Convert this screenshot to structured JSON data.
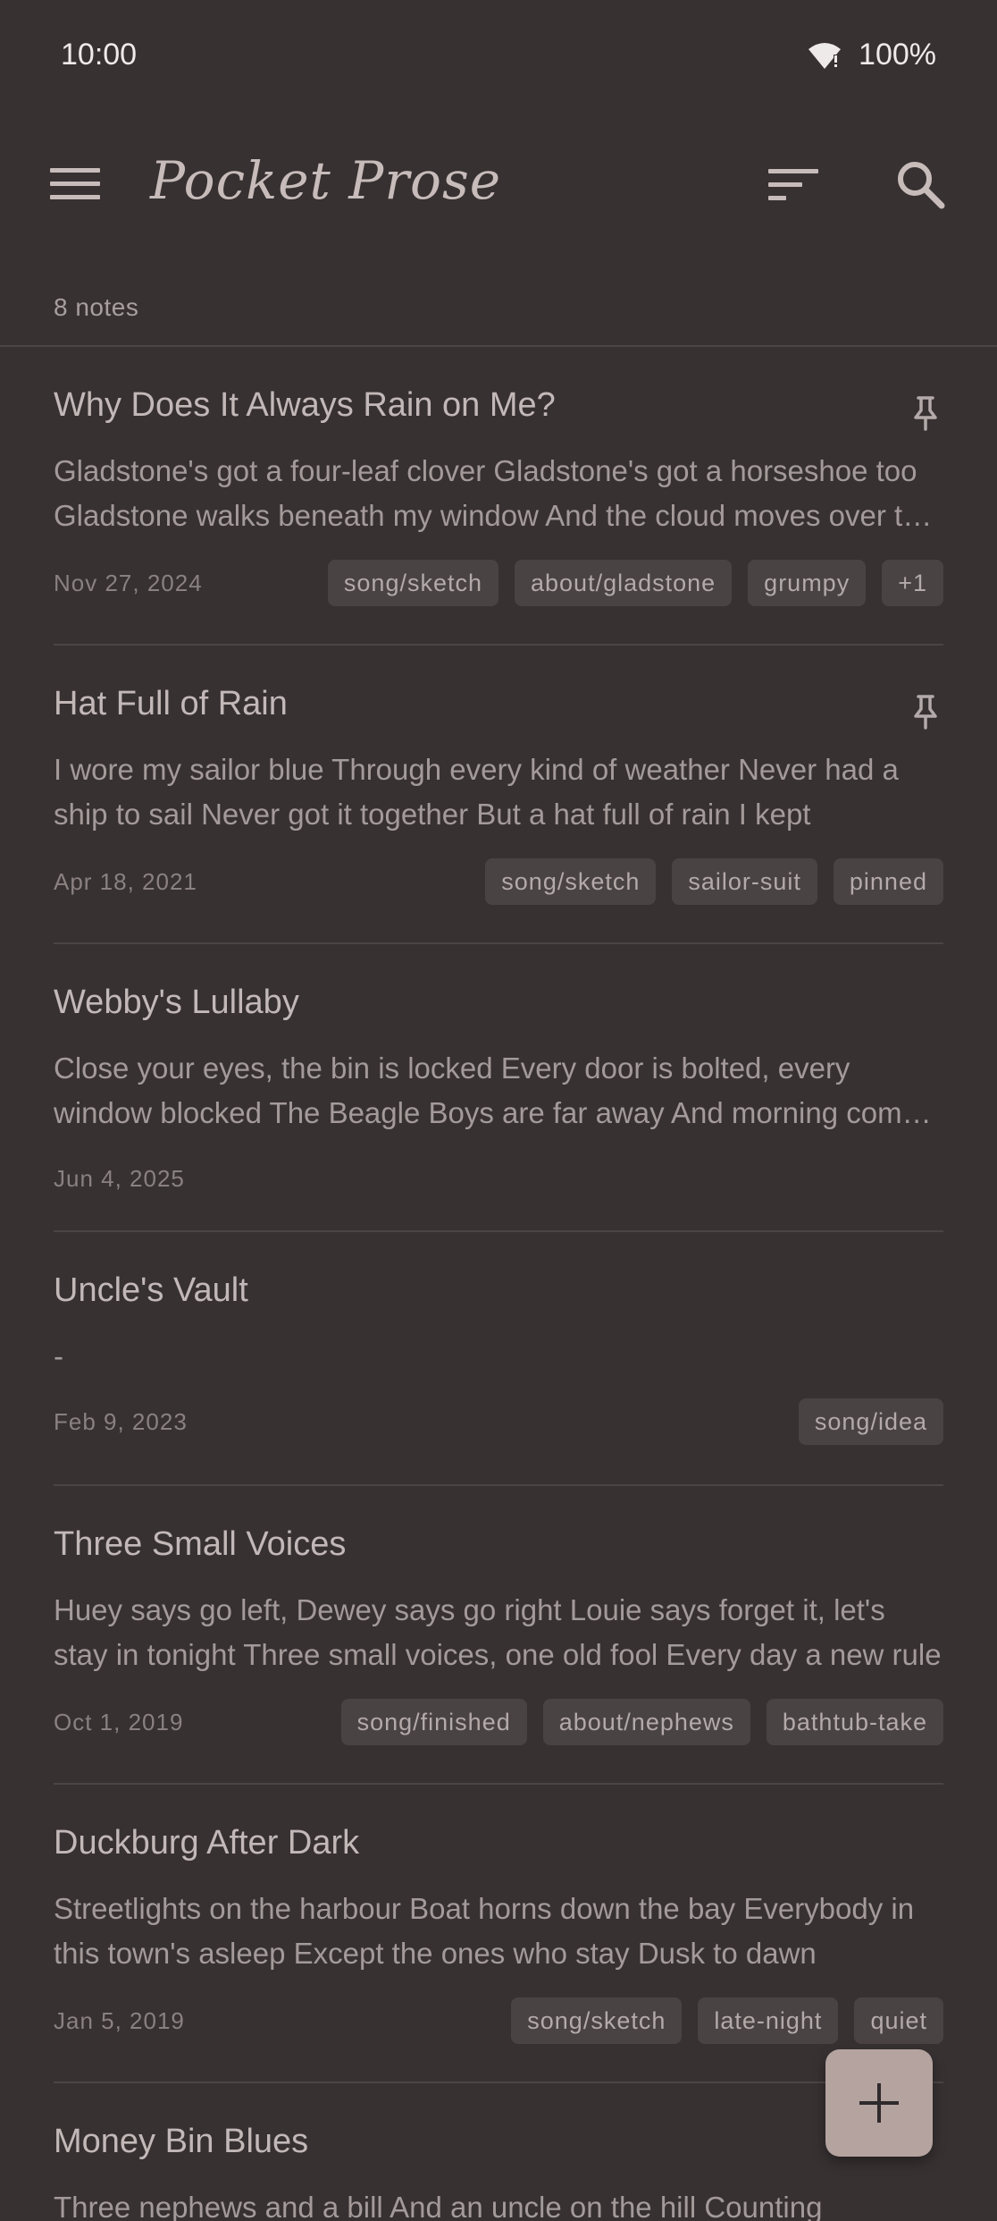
{
  "status_bar": {
    "time": "10:00",
    "battery": "100%"
  },
  "app_bar": {
    "title": "Pocket Prose"
  },
  "notes_count": "8 notes",
  "notes": [
    {
      "title": "Why Does It Always Rain on Me?",
      "pinned": true,
      "preview": "Gladstone's got a four-leaf clover Gladstone's got a horseshoe too Gladstone walks beneath my window And the cloud moves over to me",
      "date": "Nov 27, 2024",
      "tags": [
        "song/sketch",
        "about/gladstone",
        "grumpy",
        "+1"
      ]
    },
    {
      "title": "Hat Full of Rain",
      "pinned": true,
      "preview": "I wore my sailor blue Through every kind of weather Never had a ship to sail Never got it together But a hat full of rain I kept",
      "date": "Apr 18, 2021",
      "tags": [
        "song/sketch",
        "sailor-suit",
        "pinned"
      ]
    },
    {
      "title": "Webby's Lullaby",
      "pinned": false,
      "preview": "Close your eyes, the bin is locked Every door is bolted, every window blocked The Beagle Boys are far away And morning comes to stay",
      "date": "Jun 4, 2025",
      "tags": []
    },
    {
      "title": "Uncle's Vault",
      "pinned": false,
      "preview": "-",
      "date": "Feb 9, 2023",
      "tags": [
        "song/idea"
      ]
    },
    {
      "title": "Three Small Voices",
      "pinned": false,
      "preview": "Huey says go left, Dewey says go right Louie says forget it, let's stay in tonight Three small voices, one old fool Every day a new rule",
      "date": "Oct 1, 2019",
      "tags": [
        "song/finished",
        "about/nephews",
        "bathtub-take"
      ]
    },
    {
      "title": "Duckburg After Dark",
      "pinned": false,
      "preview": "Streetlights on the harbour Boat horns down the bay Everybody in this town's asleep Except the ones who stay Dusk to dawn",
      "date": "Jan 5, 2019",
      "tags": [
        "song/sketch",
        "late-night",
        "quiet"
      ]
    },
    {
      "title": "Money Bin Blues",
      "pinned": false,
      "preview": "Three nephews and a bill And an uncle on the hill Counting",
      "date": "",
      "tags": []
    }
  ]
}
